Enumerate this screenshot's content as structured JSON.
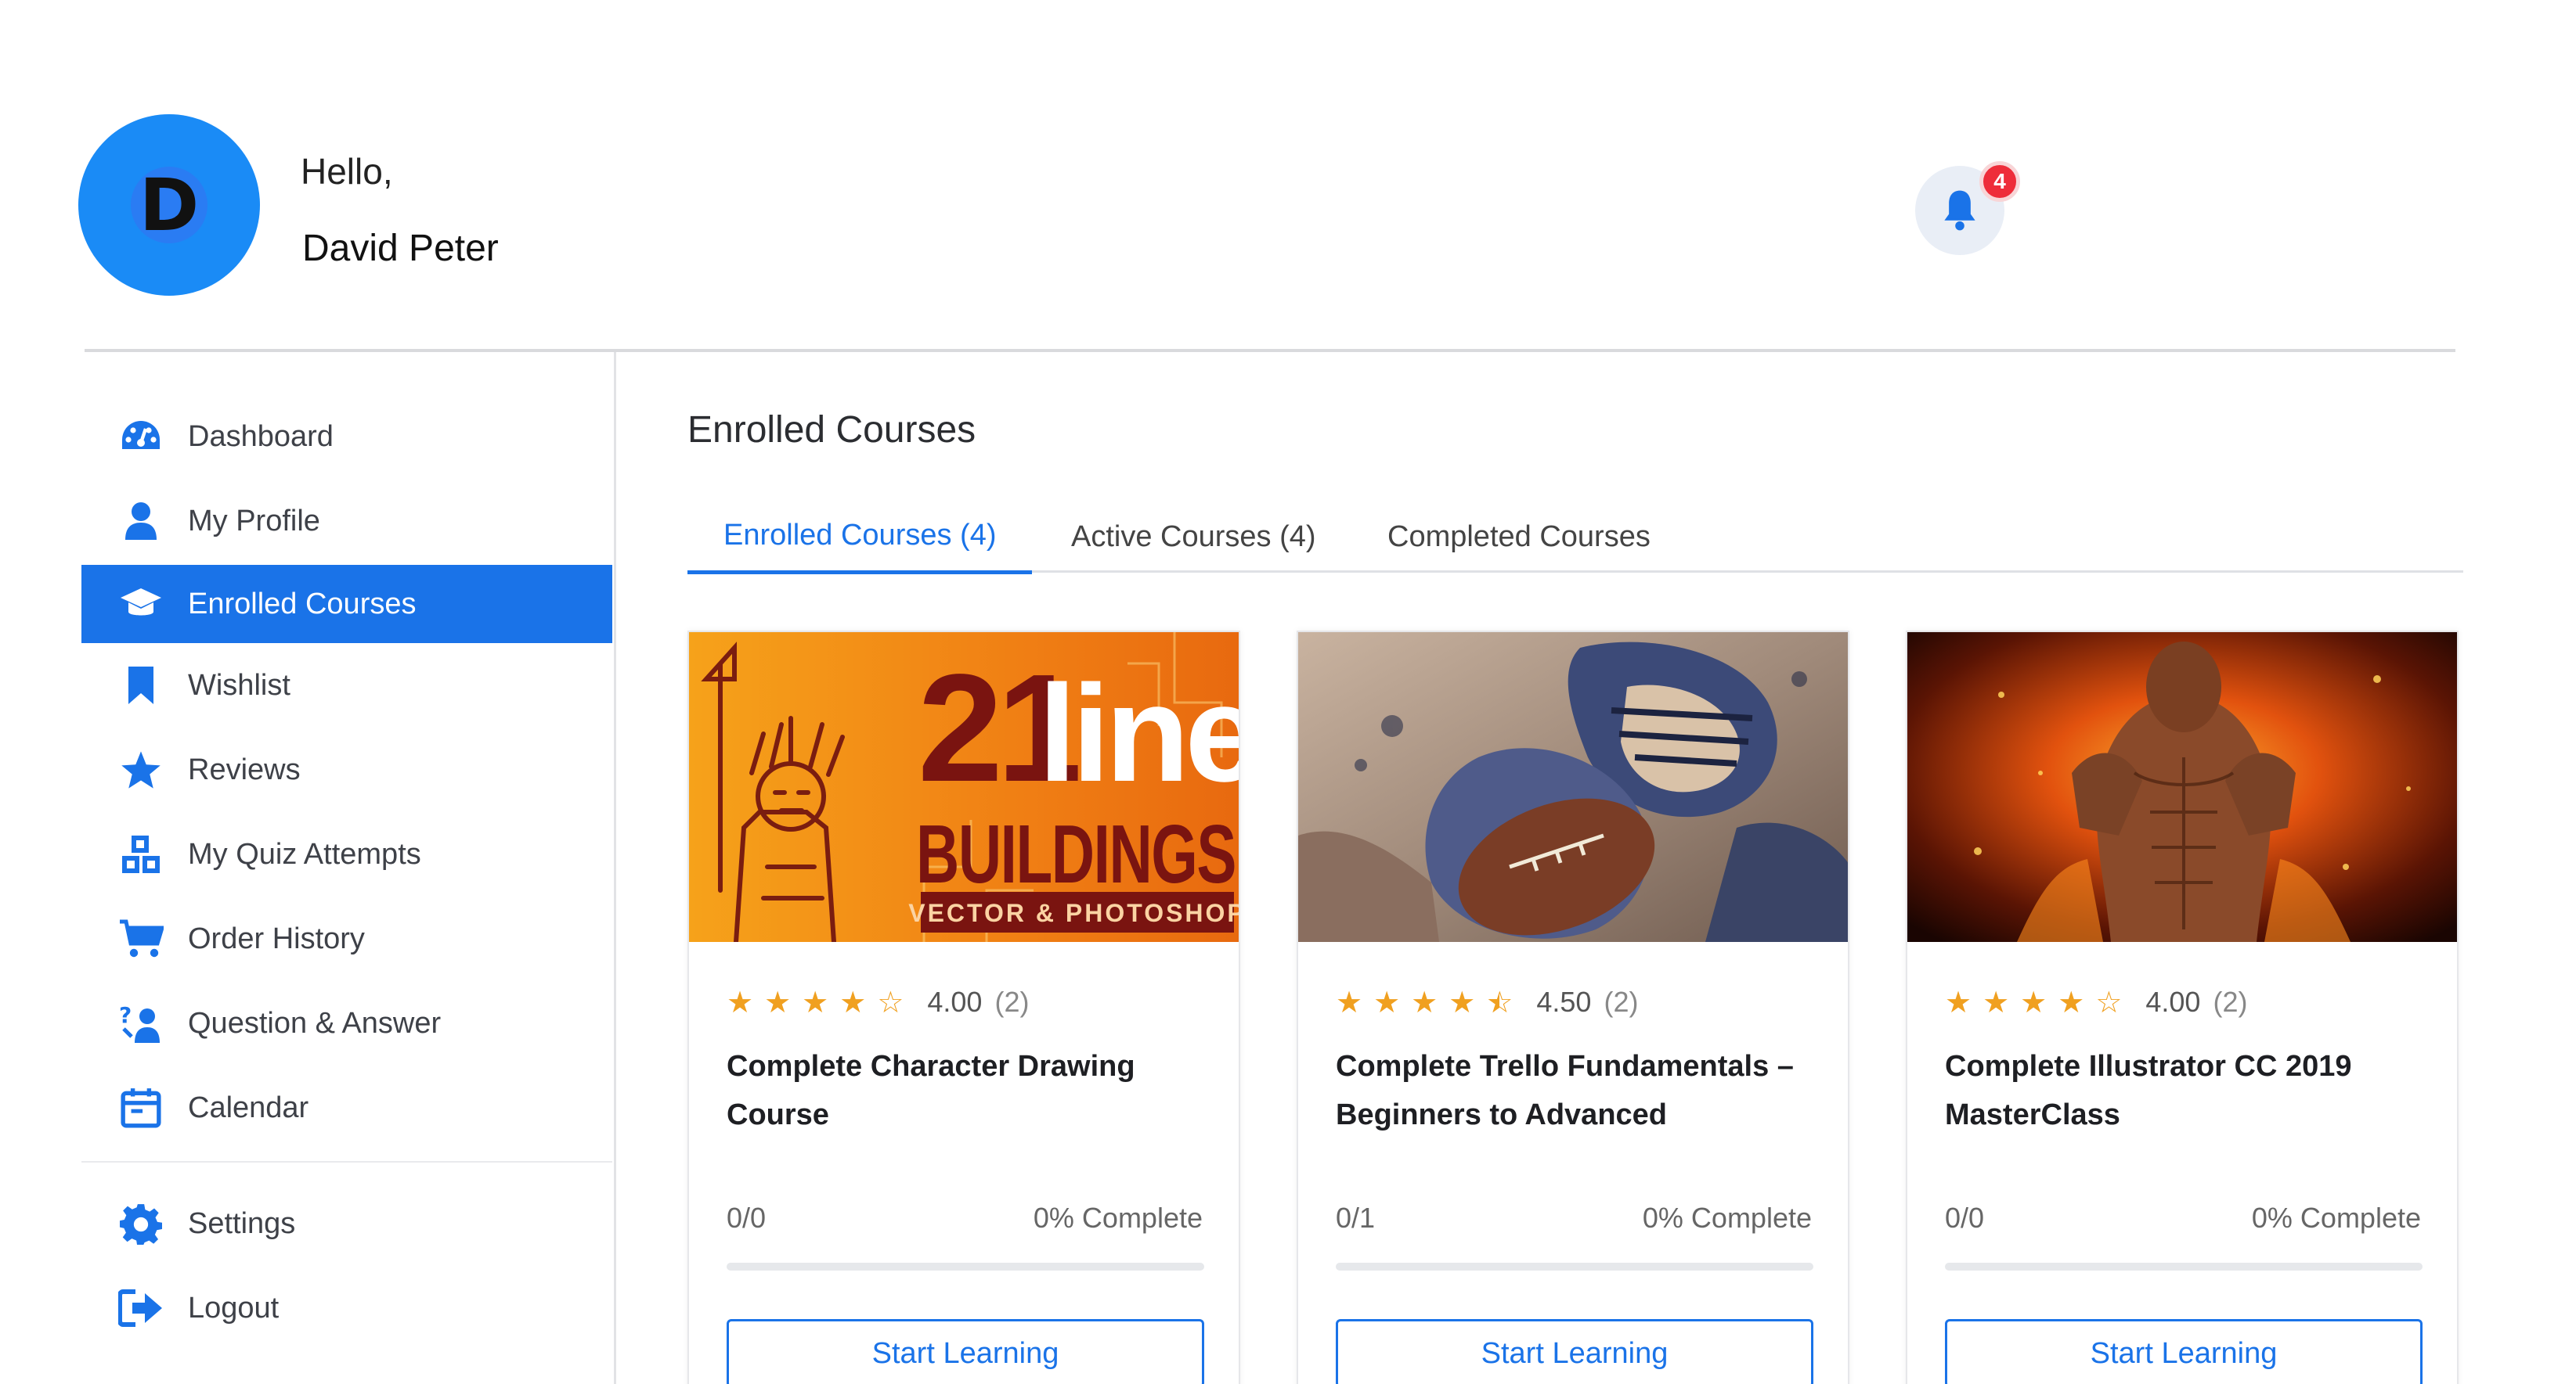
{
  "header": {
    "avatar_initial": "D",
    "greeting": "Hello,",
    "user_name": "David Peter",
    "notification_count": "4"
  },
  "sidebar": {
    "items": [
      {
        "label": "Dashboard",
        "icon": "dashboard-icon"
      },
      {
        "label": "My Profile",
        "icon": "user-icon"
      },
      {
        "label": "Enrolled Courses",
        "icon": "graduation-cap-icon",
        "active": true
      },
      {
        "label": "Wishlist",
        "icon": "bookmark-icon"
      },
      {
        "label": "Reviews",
        "icon": "star-icon"
      },
      {
        "label": "My Quiz Attempts",
        "icon": "quiz-blocks-icon"
      },
      {
        "label": "Order History",
        "icon": "cart-icon"
      },
      {
        "label": "Question & Answer",
        "icon": "question-answer-icon"
      },
      {
        "label": "Calendar",
        "icon": "calendar-icon"
      },
      {
        "label": "Settings",
        "icon": "gear-icon"
      },
      {
        "label": "Logout",
        "icon": "logout-icon"
      }
    ]
  },
  "main": {
    "title": "Enrolled Courses",
    "tabs": [
      {
        "label": "Enrolled Courses (4)",
        "active": true
      },
      {
        "label": "Active Courses (4)"
      },
      {
        "label": "Completed Courses"
      }
    ]
  },
  "courses": [
    {
      "thumb_line1": "21",
      "thumb_line2": "line",
      "thumb_line3": "BUILDINGS",
      "thumb_line4": "VECTOR & PHOTOSHOP",
      "stars": 4,
      "rating": "4.00",
      "rating_count": "(2)",
      "title": "Complete Character Drawing Course",
      "progress_count": "0/0",
      "progress_label": "0% Complete",
      "progress": 0,
      "button_label": "Start Learning"
    },
    {
      "stars": 4.5,
      "rating": "4.50",
      "rating_count": "(2)",
      "title": "Complete Trello Fundamentals – Beginners to Advanced",
      "progress_count": "0/1",
      "progress_label": "0% Complete",
      "progress": 0,
      "button_label": "Start Learning"
    },
    {
      "stars": 4,
      "rating": "4.00",
      "rating_count": "(2)",
      "title": "Complete Illustrator CC 2019 MasterClass",
      "progress_count": "0/0",
      "progress_label": "0% Complete",
      "progress": 0,
      "button_label": "Start Learning"
    }
  ],
  "colors": {
    "accent": "#1a73e8",
    "avatar": "#1a8bf6",
    "badge": "#ee2d3a",
    "star": "#f0a020"
  }
}
